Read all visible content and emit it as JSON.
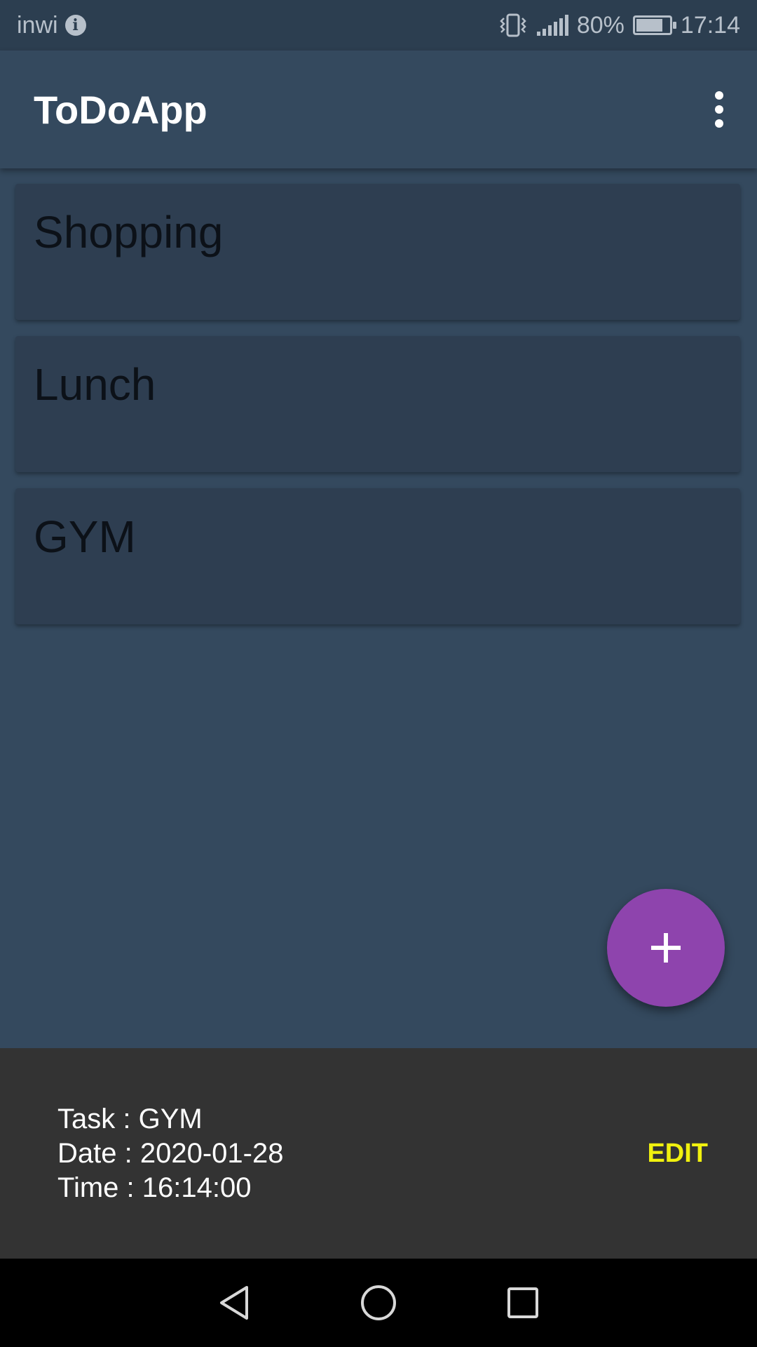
{
  "status_bar": {
    "carrier": "inwi",
    "battery_percent": "80%",
    "battery_level": 0.8,
    "time": "17:14",
    "icons": [
      "info-icon",
      "vibrate-icon",
      "signal-icon",
      "battery-icon"
    ]
  },
  "app_bar": {
    "title": "ToDoApp",
    "menu_icon": "more-vert-icon"
  },
  "tasks": [
    {
      "title": "Shopping"
    },
    {
      "title": "Lunch"
    },
    {
      "title": "GYM"
    }
  ],
  "fab": {
    "icon": "plus-icon",
    "color": "#8e44ad"
  },
  "snackbar": {
    "task_line": "Task : GYM",
    "date_line": "Date : 2020-01-28",
    "time_line": "Time : 16:14:00",
    "action_label": "EDIT",
    "action_color": "#f1f10e"
  },
  "nav_bar": {
    "buttons": [
      "back-icon",
      "home-icon",
      "recents-icon"
    ]
  },
  "colors": {
    "background": "#34495e",
    "status_bar": "#2c3e50",
    "card": "#2e3e51",
    "snackbar": "#333333"
  }
}
